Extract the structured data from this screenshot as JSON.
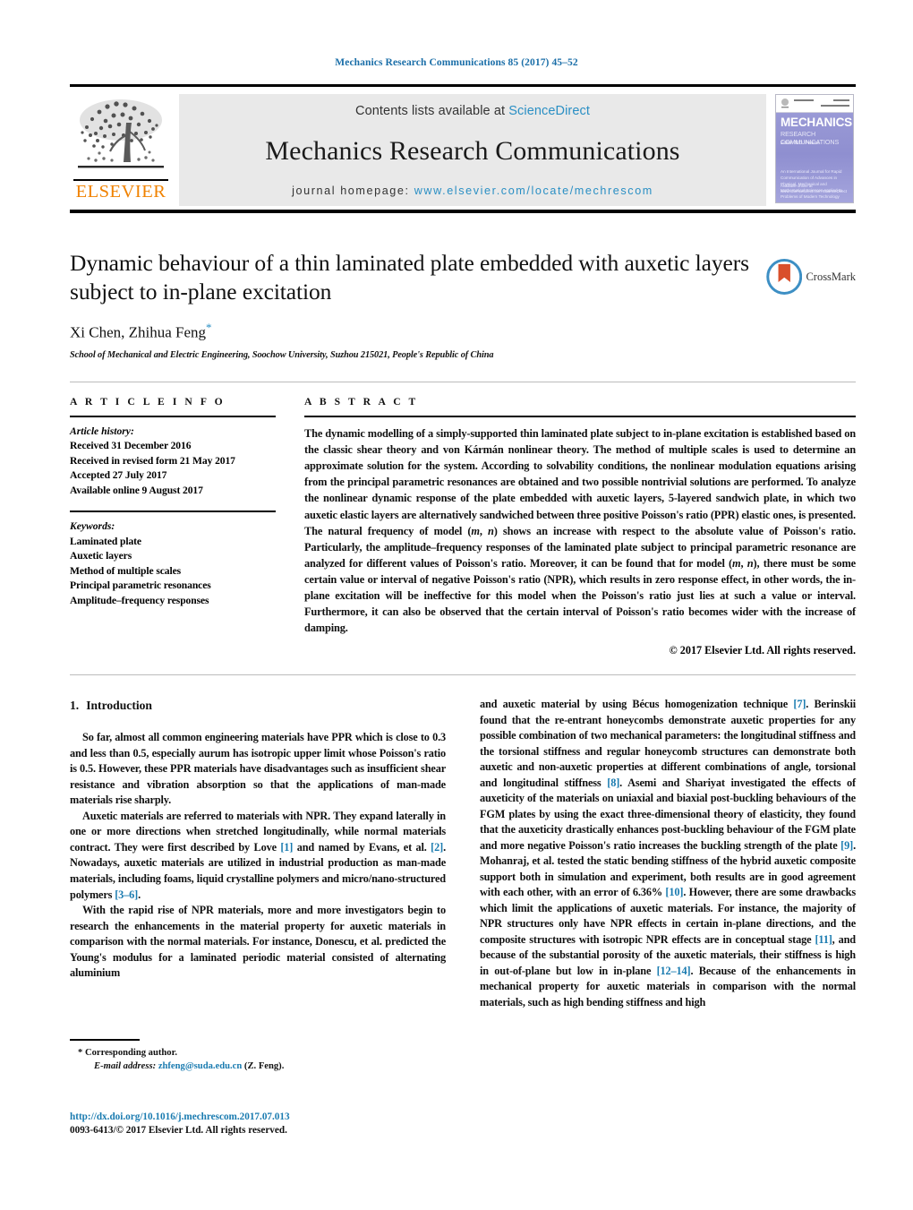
{
  "running_head": "Mechanics Research Communications 85 (2017) 45–52",
  "masthead": {
    "publisher_logo_text": "ELSEVIER",
    "contents_prefix": "Contents lists available at ",
    "contents_link": "ScienceDirect",
    "journal_title": "Mechanics Research Communications",
    "homepage_prefix": "journal homepage: ",
    "homepage_url": "www.elsevier.com/locate/mechrescom",
    "cover": {
      "title": "MECHANICS",
      "subtitle": "RESEARCH COMMUNICATIONS",
      "editor": "Editor: N.D. Pearce",
      "body": "An International Journal for Rapid Communication of Advances in Physical, Mechanical and Mathematical Sciences Applied to Problems of Modern Technology",
      "footer": "Available online at\nwww.sciencedirect.com ScienceDirect"
    }
  },
  "article": {
    "title": "Dynamic behaviour of a thin laminated plate embedded with auxetic layers subject to in-plane excitation",
    "crossmark_label": "CrossMark",
    "authors": "Xi Chen, Zhihua Feng",
    "corresponding_marker": "*",
    "affiliation": "School of Mechanical and Electric Engineering, Soochow University, Suzhou 215021, People's Republic of China"
  },
  "info": {
    "heading": "A R T I C L E   I N F O",
    "history_label": "Article history:",
    "history": [
      "Received 31 December 2016",
      "Received in revised form 21 May 2017",
      "Accepted 27 July 2017",
      "Available online 9 August 2017"
    ],
    "keywords_label": "Keywords:",
    "keywords": [
      "Laminated plate",
      "Auxetic layers",
      "Method of multiple scales",
      "Principal parametric resonances",
      "Amplitude–frequency responses"
    ]
  },
  "abstract": {
    "heading": "A B S T R A C T",
    "text": "The dynamic modelling of a simply-supported thin laminated plate subject to in-plane excitation is established based on the classic shear theory and von Kármán nonlinear theory. The method of multiple scales is used to determine an approximate solution for the system. According to solvability conditions, the nonlinear modulation equations arising from the principal parametric resonances are obtained and two possible nontrivial solutions are performed. To analyze the nonlinear dynamic response of the plate embedded with auxetic layers, 5-layered sandwich plate, in which two auxetic elastic layers are alternatively sandwiched between three positive Poisson's ratio (PPR) elastic ones, is presented. The natural frequency of model (m, n) shows an increase with respect to the absolute value of Poisson's ratio. Particularly, the amplitude–frequency responses of the laminated plate subject to principal parametric resonance are analyzed for different values of Poisson's ratio. Moreover, it can be found that for model (m, n), there must be some certain value or interval of negative Poisson's ratio (NPR), which results in zero response effect, in other words, the in-plane excitation will be ineffective for this model when the Poisson's ratio just lies at such a value or interval. Furthermore, it can also be observed that the certain interval of Poisson's ratio becomes wider with the increase of damping.",
    "copyright": "© 2017 Elsevier Ltd. All rights reserved."
  },
  "section": {
    "number": "1.",
    "title": "Introduction"
  },
  "body": {
    "left_paragraphs": [
      "So far, almost all common engineering materials have PPR which is close to 0.3 and less than 0.5, especially aurum has isotropic upper limit whose Poisson's ratio is 0.5. However, these PPR materials have disadvantages such as insufficient shear resistance and vibration absorption so that the applications of man-made materials rise sharply.",
      "Auxetic materials are referred to materials with NPR. They expand laterally in one or more directions when stretched longitudinally, while normal materials contract. They were first described by Love [1] and named by Evans, et al. [2]. Nowadays, auxetic materials are utilized in industrial production as man-made materials, including foams, liquid crystalline polymers and micro/nano-structured polymers [3–6].",
      "With the rapid rise of NPR materials, more and more investigators begin to research the enhancements in the material property for auxetic materials in comparison with the normal materials. For instance, Donescu, et al. predicted the Young's modulus for a laminated periodic material consisted of alternating aluminium"
    ],
    "right_paragraphs": [
      "and auxetic material by using Bécus homogenization technique [7]. Berinskii found that the re-entrant honeycombs demonstrate auxetic properties for any possible combination of two mechanical parameters: the longitudinal stiffness and the torsional stiffness and regular honeycomb structures can demonstrate both auxetic and non-auxetic properties at different combinations of angle, torsional and longitudinal stiffness [8]. Asemi and Shariyat investigated the effects of auxeticity of the materials on uniaxial and biaxial post-buckling behaviours of the FGM plates by using the exact three-dimensional theory of elasticity, they found that the auxeticity drastically enhances post-buckling behaviour of the FGM plate and more negative Poisson's ratio increases the buckling strength of the plate [9]. Mohanraj, et al. tested the static bending stiffness of the hybrid auxetic composite support both in simulation and experiment, both results are in good agreement with each other, with an error of 6.36% [10]. However, there are some drawbacks which limit the applications of auxetic materials. For instance, the majority of NPR structures only have NPR effects in certain in-plane directions, and the composite structures with isotropic NPR effects are in conceptual stage [11], and because of the substantial porosity of the auxetic materials, their stiffness is high in out-of-plane but low in in-plane [12–14]. Because of the enhancements in mechanical property for auxetic materials in comparison with the normal materials, such as high bending stiffness and high"
    ]
  },
  "footnote": {
    "corresponding": "* Corresponding author.",
    "email_label": "E-mail address:",
    "email": "zhfeng@suda.edu.cn",
    "email_suffix": "(Z. Feng)."
  },
  "footer": {
    "doi": "http://dx.doi.org/10.1016/j.mechrescom.2017.07.013",
    "issn_line": "0093-6413/© 2017 Elsevier Ltd. All rights reserved."
  },
  "colors": {
    "link": "#1a7bb0",
    "sciencedirect": "#2a8fc4",
    "elsevier_orange": "#F08200",
    "running_head": "#1a6ea8"
  }
}
